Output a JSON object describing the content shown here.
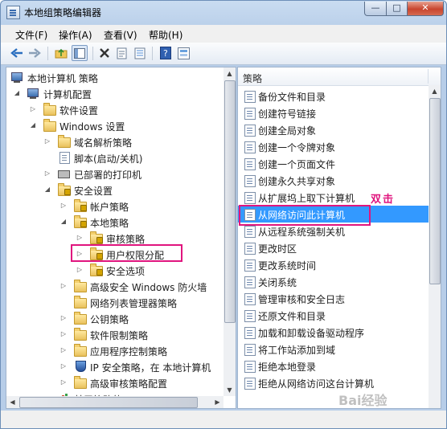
{
  "window": {
    "title": "本地组策略编辑器",
    "min_glyph": "—",
    "max_glyph": "□",
    "close_glyph": "✕"
  },
  "menu": {
    "items": [
      "文件(F)",
      "操作(A)",
      "查看(V)",
      "帮助(H)"
    ]
  },
  "left_tree": {
    "root": "本地计算机 策略",
    "items": [
      "计算机配置",
      "软件设置",
      "Windows 设置",
      "域名解析策略",
      "脚本(启动/关机)",
      "已部署的打印机",
      "安全设置",
      "帐户策略",
      "本地策略",
      "审核策略",
      "用户权限分配",
      "安全选项",
      "高级安全 Windows 防火墙",
      "网络列表管理器策略",
      "公钥策略",
      "软件限制策略",
      "应用程序控制策略",
      "IP 安全策略，在 本地计算机",
      "高级审核策略配置",
      "基于策略的 QoS"
    ]
  },
  "right_list": {
    "column_header": "策略",
    "selected_index": 7,
    "items": [
      "备份文件和目录",
      "创建符号链接",
      "创建全局对象",
      "创建一个令牌对象",
      "创建一个页面文件",
      "创建永久共享对象",
      "从扩展坞上取下计算机",
      "从网络访问此计算机",
      "从远程系统强制关机",
      "更改时区",
      "更改系统时间",
      "关闭系统",
      "管理审核和安全日志",
      "还原文件和目录",
      "加载和卸载设备驱动程序",
      "将工作站添加到域",
      "拒绝本地登录",
      "拒绝从网络访问这台计算机"
    ]
  },
  "annotation": "双击",
  "watermark": "Bai经验",
  "colors": {
    "highlight_box": "#e0157e",
    "selection": "#3399ff"
  }
}
